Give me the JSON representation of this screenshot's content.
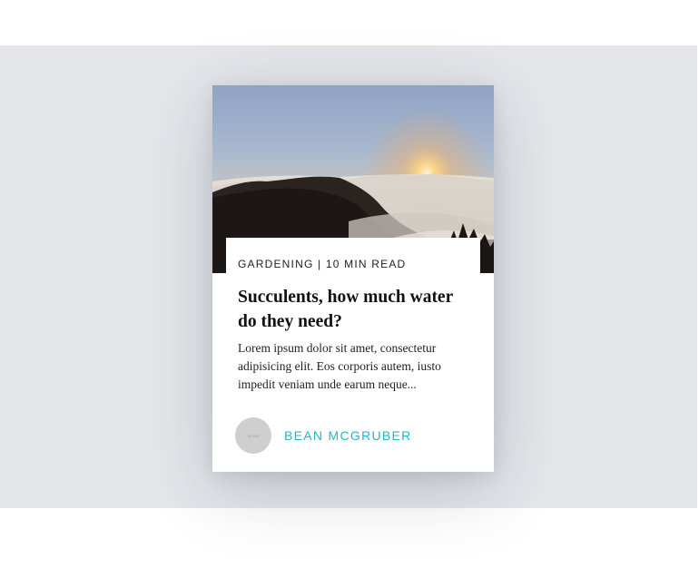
{
  "card": {
    "image": {
      "alt": "",
      "icon": "sunrise-over-clouds-photo"
    },
    "meta": "GARDENING | 10 MIN READ",
    "title": "Succulents, how much water do they need?",
    "excerpt": "Lorem ipsum dolor sit amet, consectetur adipisicing elit. Eos corporis autem, iusto impedit veniam unde earum neque...",
    "author": {
      "avatar_text": "50×50",
      "name": "BEAN MCGRUBER"
    }
  },
  "colors": {
    "backdrop": "#e4e6ea",
    "card": "#ffffff",
    "author_link": "#2bb3c5",
    "avatar": "#cfcfcf"
  }
}
